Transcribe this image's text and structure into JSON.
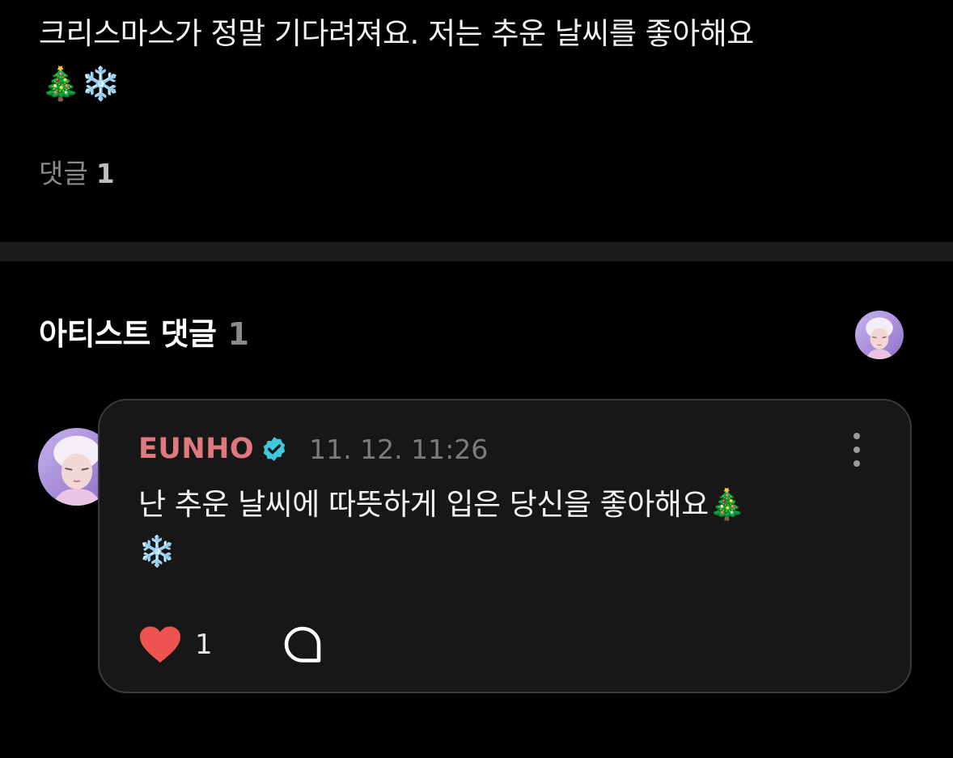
{
  "post": {
    "text": "크리스마스가 정말 기다려져요. 저는 추운 날씨를 좋아해요",
    "emoji_line": "🎄❄️",
    "comment_count_label": "댓글",
    "comment_count_value": "1"
  },
  "artist_comments": {
    "header_label": "아티스트 댓글",
    "header_count": "1",
    "header_avatar_icon": "artist-avatar"
  },
  "comment": {
    "author": "EUNHO",
    "verified_icon": "verified-badge-icon",
    "timestamp": "11. 12. 11:26",
    "body_line1": "난 추운 날씨에 따뜻하게 입은 당신을 좋아해요🎄",
    "body_line2": "❄️",
    "like_count": "1",
    "like_icon": "heart-icon",
    "reply_icon": "reply-bubble-icon",
    "more_icon": "more-vertical-icon"
  },
  "colors": {
    "background": "#000000",
    "divider": "#1c1c1c",
    "card_background": "#171717",
    "card_border": "#3a3a3a",
    "author_name": "#e07880",
    "verified_badge": "#3fc7df",
    "heart": "#ef5350",
    "muted_text": "#8a8a8a"
  }
}
